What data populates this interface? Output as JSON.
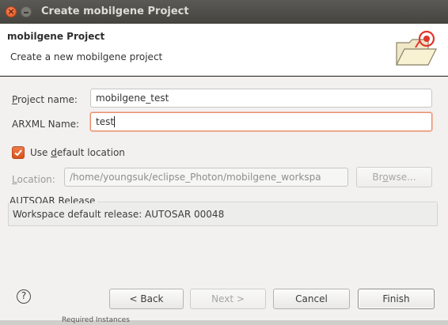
{
  "window": {
    "title": "Create mobilgene Project",
    "close_glyph": "×"
  },
  "header": {
    "title": "mobilgene Project",
    "description": "Create a new mobilgene project",
    "icon": "open-folder-wizard-icon"
  },
  "form": {
    "project_name": {
      "label_prefix": "P",
      "label_rest": "roject name:",
      "value": "mobilgene_test"
    },
    "arxml_name": {
      "label": "ARXML Name:",
      "value": "test"
    },
    "use_default_location": {
      "label_prefix": "Use ",
      "label_underline": "d",
      "label_rest": "efault location",
      "checked": true
    },
    "location": {
      "label_prefix": "L",
      "label_rest": "ocation:",
      "value": "/home/youngsuk/eclipse_Photon/mobilgene_workspa",
      "enabled": false
    },
    "browse_button": {
      "label_prefix": "Br",
      "label_underline": "o",
      "label_rest": "wse..."
    },
    "release_group": {
      "legend": "AUTSOAR Release",
      "text": "Workspace default release:  AUTOSAR 00048"
    }
  },
  "footer": {
    "help_glyph": "?",
    "back": "< Back",
    "next": "Next >",
    "cancel": "Cancel",
    "finish": "Finish"
  },
  "bottom_strip": {
    "text": "Required Instances"
  },
  "colors": {
    "accent": "#e2501d",
    "titlebar": "#4f4e4a",
    "panel": "#f2f1f0"
  }
}
